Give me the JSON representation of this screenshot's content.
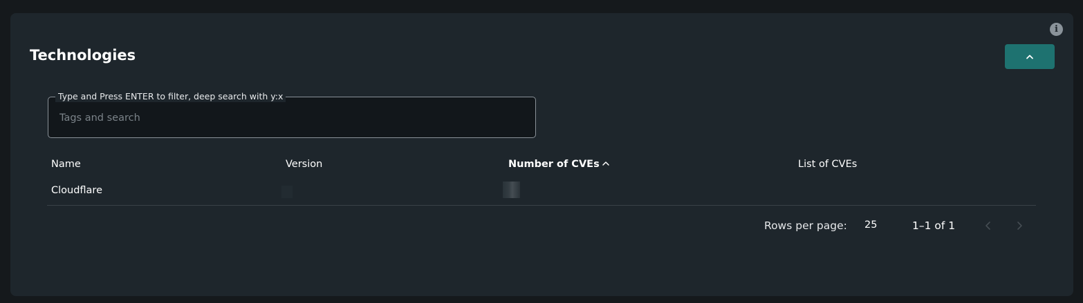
{
  "panel": {
    "title": "Technologies",
    "info_icon": "info-icon",
    "collapse_icon": "chevron-up-icon",
    "accent_color": "#1e7270"
  },
  "search": {
    "legend": "Type and Press ENTER to filter, deep search with y:x",
    "placeholder": "Tags and search",
    "value": ""
  },
  "table": {
    "columns": [
      "Name",
      "Version",
      "Number of CVEs",
      "List of CVEs"
    ],
    "sorted_column": "Number of CVEs",
    "sort_direction": "ascending",
    "rows": [
      {
        "name": "Cloudflare",
        "version": "",
        "cve_count": "",
        "cve_list": ""
      }
    ]
  },
  "pagination": {
    "rows_per_page_label": "Rows per page:",
    "rows_per_page": "25",
    "range": "1–1 of 1",
    "prev_icon": "chevron-left-icon",
    "next_icon": "chevron-right-icon"
  }
}
